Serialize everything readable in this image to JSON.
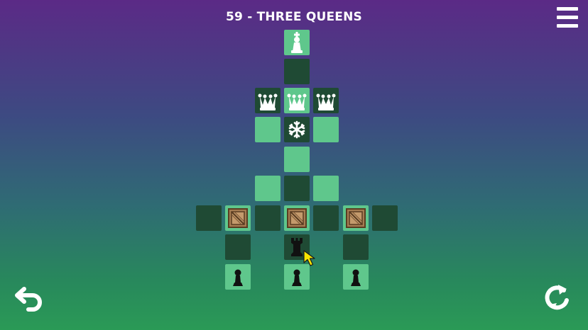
{
  "header": {
    "title": "59 - THREE QUEENS"
  },
  "controls": {
    "menu_icon": "hamburger-menu-icon",
    "undo_icon": "undo-arrow-icon",
    "restart_icon": "restart-cycle-icon"
  },
  "colors": {
    "tile_light": "#5fc78c",
    "tile_dark": "#1f4a34",
    "piece_white": "#ffffff",
    "piece_black": "#111111",
    "cursor": "#f5e400"
  },
  "board": {
    "pieces": [
      {
        "name": "white-king",
        "icon": "chess-king-icon",
        "color": "white"
      },
      {
        "name": "white-queen-left",
        "icon": "chess-queen-icon",
        "color": "white"
      },
      {
        "name": "white-queen-center",
        "icon": "chess-queen-icon",
        "color": "white"
      },
      {
        "name": "white-queen-right",
        "icon": "chess-queen-icon",
        "color": "white"
      },
      {
        "name": "snowflake",
        "icon": "snowflake-icon",
        "color": "white"
      },
      {
        "name": "crate-left",
        "icon": "wooden-crate-icon"
      },
      {
        "name": "crate-center",
        "icon": "wooden-crate-icon"
      },
      {
        "name": "crate-right",
        "icon": "wooden-crate-icon"
      },
      {
        "name": "black-rook",
        "icon": "chess-rook-icon",
        "color": "black"
      },
      {
        "name": "black-pawn-left",
        "icon": "chess-pawn-icon",
        "color": "black"
      },
      {
        "name": "black-pawn-center",
        "icon": "chess-pawn-icon",
        "color": "black"
      },
      {
        "name": "black-pawn-right",
        "icon": "chess-pawn-icon",
        "color": "black"
      }
    ]
  }
}
